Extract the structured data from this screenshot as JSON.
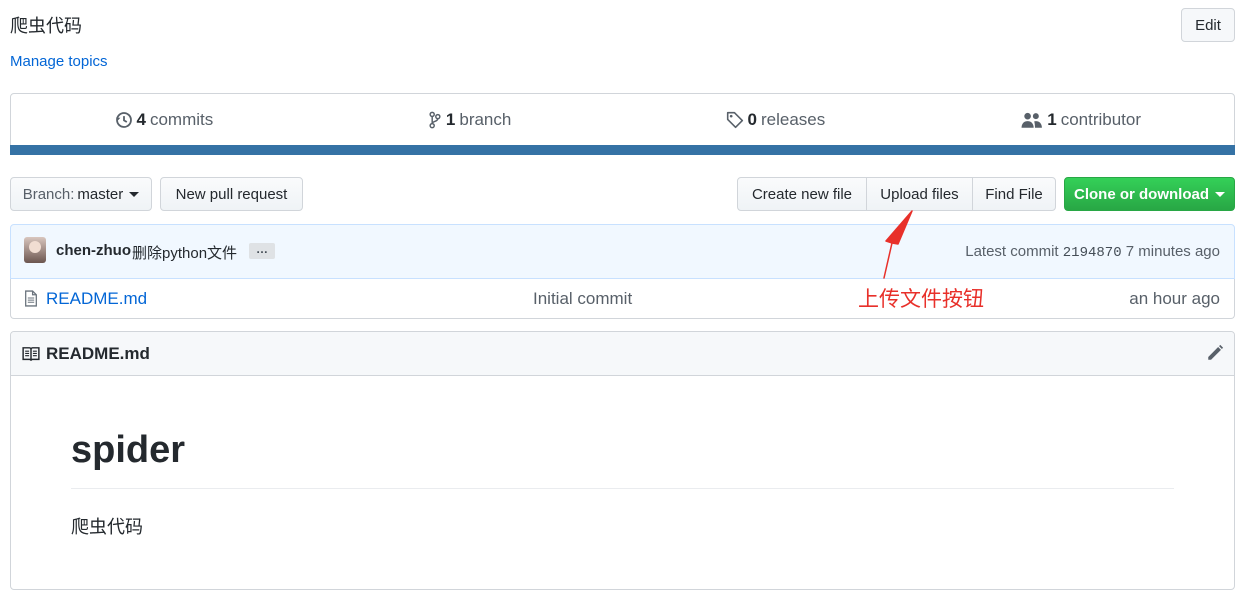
{
  "repo": {
    "description": "爬虫代码",
    "edit_label": "Edit",
    "manage_topics": "Manage topics"
  },
  "summary": {
    "commits_count": "4",
    "commits_label": "commits",
    "branch_count": "1",
    "branch_label": "branch",
    "releases_count": "0",
    "releases_label": "releases",
    "contributor_count": "1",
    "contributor_label": "contributor"
  },
  "language_bar_color": "#3572a5",
  "toolbar": {
    "branch_prefix": "Branch:",
    "branch_name": "master",
    "new_pull_request": "New pull request",
    "create_new_file": "Create new file",
    "upload_files": "Upload files",
    "find_file": "Find File",
    "clone_or_download": "Clone or download"
  },
  "latest_commit": {
    "author": "chen-zhuo",
    "message": "删除python文件",
    "ellipsis": "…",
    "prefix": "Latest commit",
    "sha": "2194870",
    "age": "7 minutes ago"
  },
  "files": [
    {
      "name": "README.md",
      "message": "Initial commit",
      "age": "an hour ago",
      "icon": "file-icon"
    }
  ],
  "annotation": {
    "text": "上传文件按钮",
    "color": "#e8302a"
  },
  "readme": {
    "title": "README.md",
    "heading": "spider",
    "body": "爬虫代码"
  }
}
